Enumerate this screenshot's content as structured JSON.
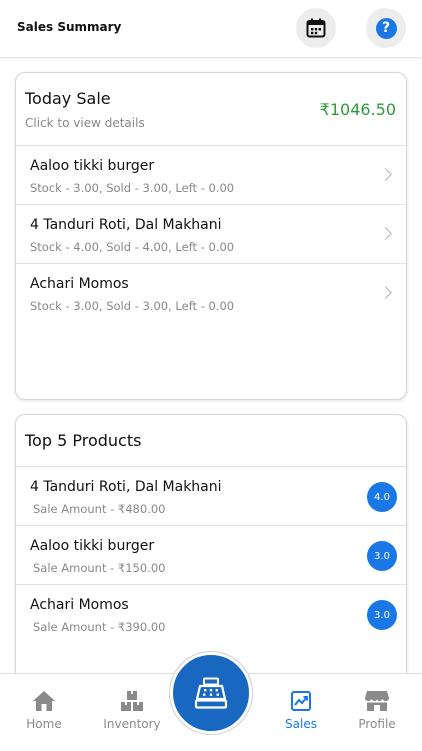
{
  "header": {
    "title": "Sales Summary",
    "calendar_icon": "calendar-icon",
    "help_icon": "help-icon",
    "help_glyph": "?"
  },
  "today_sale": {
    "title": "Today Sale",
    "subtitle": "Click to view details",
    "amount": "₹1046.50",
    "items": [
      {
        "name": "Aaloo tikki burger",
        "detail": "Stock - 3.00, Sold - 3.00, Left - 0.00"
      },
      {
        "name": "4 Tanduri Roti, Dal Makhani",
        "detail": "Stock - 4.00, Sold - 4.00, Left - 0.00"
      },
      {
        "name": "Achari Momos",
        "detail": "Stock - 3.00, Sold - 3.00, Left - 0.00"
      }
    ]
  },
  "top_products": {
    "title": "Top 5 Products",
    "items": [
      {
        "name": "4 Tanduri Roti, Dal Makhani",
        "detail": "Sale Amount - ₹480.00",
        "qty": "4.0"
      },
      {
        "name": "Aaloo tikki burger",
        "detail": "Sale Amount - ₹150.00",
        "qty": "3.0"
      },
      {
        "name": "Achari Momos",
        "detail": "Sale Amount - ₹390.00",
        "qty": "3.0"
      }
    ]
  },
  "nav": {
    "home": "Home",
    "inventory": "Inventory",
    "sales": "Sales",
    "profile": "Profile",
    "active": "sales"
  },
  "colors": {
    "accent": "#1a78e6",
    "fab": "#1867c0",
    "amount": "#2e9b3a"
  }
}
